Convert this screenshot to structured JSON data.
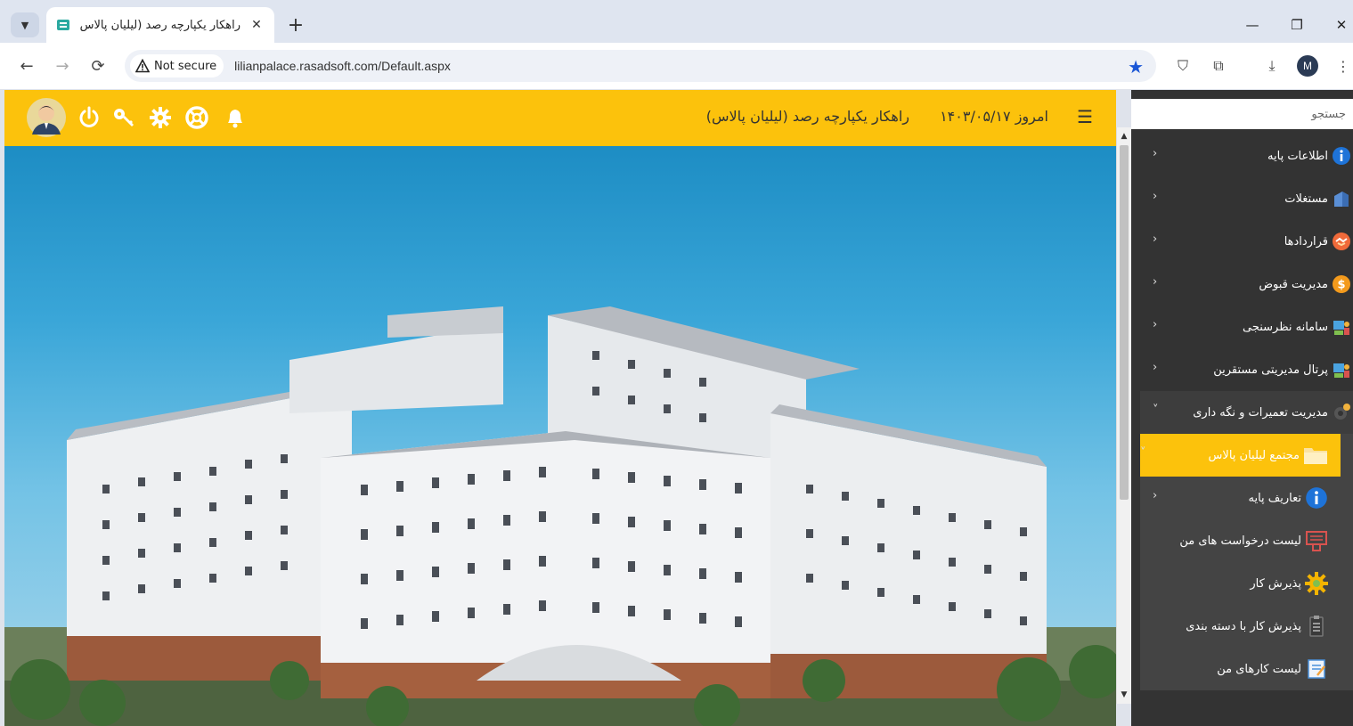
{
  "browser": {
    "tab_title": "راهکار یکپارچه رصد (لیلیان پالاس)",
    "tab_close": "✕",
    "new_tab": "+",
    "security_label": "Not secure",
    "url": "lilianpalace.rasadsoft.com/Default.aspx",
    "profile_initial": "M",
    "controls": {
      "minimize": "—",
      "restore": "❐",
      "close": "✕"
    }
  },
  "header": {
    "title": "راهکار یکپارچه رصد (لیلیان پالاس)",
    "date": "امروز ۱۴۰۳/۰۵/۱۷",
    "color": "#fcc20c"
  },
  "sidebar": {
    "search_placeholder": "جستجو",
    "items": [
      {
        "label": "اطلاعات پایه",
        "icon": "info-icon",
        "arrow": "‹"
      },
      {
        "label": "مستغلات",
        "icon": "building-icon",
        "arrow": "‹"
      },
      {
        "label": "قراردادها",
        "icon": "handshake-icon",
        "arrow": "‹"
      },
      {
        "label": "مدیریت قبوض",
        "icon": "dollar-icon",
        "arrow": "‹"
      },
      {
        "label": "سامانه نظرسنجی",
        "icon": "survey-icon",
        "arrow": "‹"
      },
      {
        "label": "پرتال مدیریتی مستقرین",
        "icon": "portal-icon",
        "arrow": "‹"
      },
      {
        "label": "مدیریت تعمیرات و نگه داری",
        "icon": "repair-gear-icon",
        "arrow": "˅"
      }
    ],
    "subitems": [
      {
        "label": "مجتمع لیلیان پالاس",
        "icon": "folder-icon",
        "arrow": "˅"
      },
      {
        "label": "تعاریف پایه",
        "icon": "info-icon",
        "arrow": "‹"
      },
      {
        "label": "لیست درخواست های من",
        "icon": "request-list-icon"
      },
      {
        "label": "پذیرش کار",
        "icon": "sun-gear-icon"
      },
      {
        "label": "پذیرش کار با دسته بندی",
        "icon": "clipboard-icon"
      },
      {
        "label": "لیست کارهای من",
        "icon": "task-list-icon"
      }
    ]
  }
}
